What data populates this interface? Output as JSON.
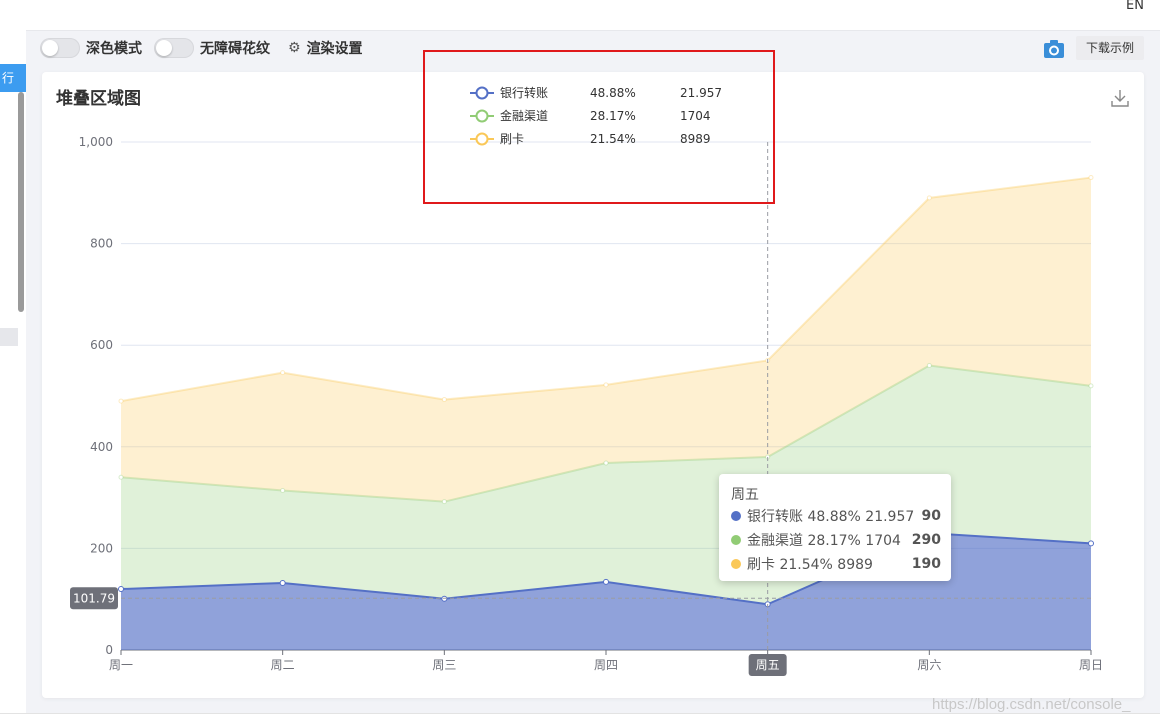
{
  "topbar": {
    "lang": "EN"
  },
  "left": {
    "tab_label": "行"
  },
  "controls": {
    "dark_mode": "深色模式",
    "aria_pattern": "无障碍花纹",
    "render_settings": "渲染设置",
    "download_example": "下载示例"
  },
  "card": {
    "title": "堆叠区域图"
  },
  "chart_data": {
    "type": "area",
    "title": "堆叠区域图",
    "stacked": true,
    "categories": [
      "周一",
      "周二",
      "周三",
      "周四",
      "周五",
      "周六",
      "周日"
    ],
    "ylim": [
      0,
      1000
    ],
    "yticks": [
      "0",
      "200",
      "400",
      "600",
      "800",
      "1,000"
    ],
    "grid": true,
    "legend_position": "top-center",
    "series": [
      {
        "name": "银行转账",
        "percent": "48.88%",
        "value_label": "21.957",
        "color": "#5470c6",
        "values": [
          120,
          132,
          101,
          134,
          90,
          230,
          210
        ]
      },
      {
        "name": "金融渠道",
        "percent": "28.17%",
        "value_label": "1704",
        "color": "#91cc75",
        "values": [
          220,
          182,
          191,
          234,
          290,
          330,
          310
        ]
      },
      {
        "name": "刷卡",
        "percent": "21.54%",
        "value_label": "8989",
        "color": "#fac858",
        "values": [
          150,
          232,
          201,
          154,
          190,
          330,
          410
        ]
      }
    ],
    "axis_pointer": {
      "x_label": "周五",
      "y_label": "101.79"
    }
  },
  "tooltip": {
    "title": "周五",
    "rows": [
      {
        "label": "银行转账 48.88% 21.957",
        "value": "90",
        "color": "#5470c6"
      },
      {
        "label": "金融渠道 28.17% 1704",
        "value": "290",
        "color": "#91cc75"
      },
      {
        "label": "刷卡 21.54% 8989",
        "value": "190",
        "color": "#fac858"
      }
    ]
  },
  "watermark": "https://blog.csdn.net/console_"
}
